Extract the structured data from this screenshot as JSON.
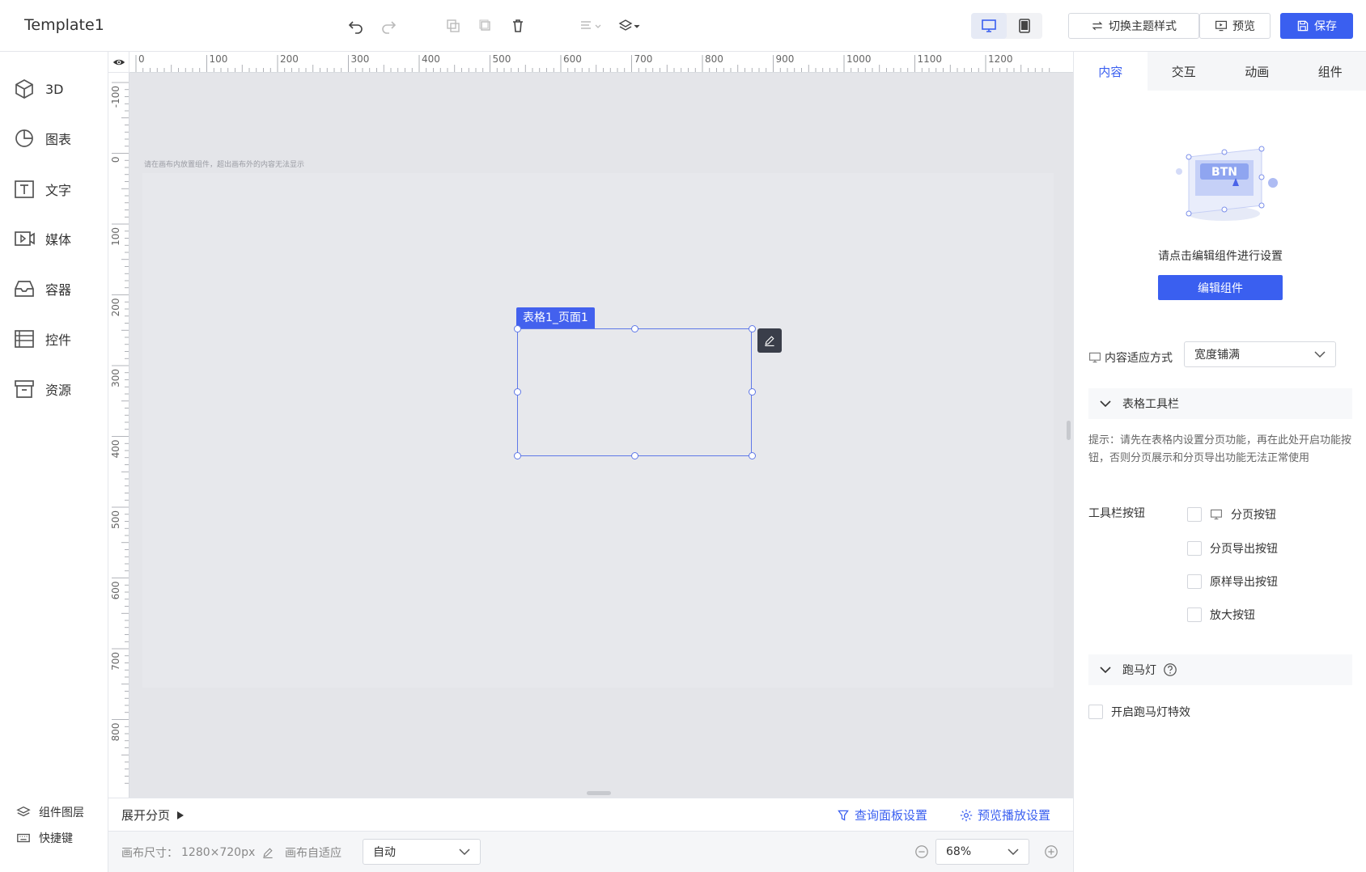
{
  "app": {
    "title": "Template1"
  },
  "toolbar": {
    "switch_theme_label": "切换主题样式",
    "preview_label": "预览",
    "save_label": "保存"
  },
  "sidebar": {
    "items": [
      {
        "label": "3D",
        "icon": "cube-icon"
      },
      {
        "label": "图表",
        "icon": "pie-chart-icon"
      },
      {
        "label": "文字",
        "icon": "text-icon"
      },
      {
        "label": "媒体",
        "icon": "media-icon"
      },
      {
        "label": "容器",
        "icon": "container-icon"
      },
      {
        "label": "控件",
        "icon": "control-icon"
      },
      {
        "label": "资源",
        "icon": "resource-icon"
      }
    ],
    "bottom": [
      {
        "label": "组件图层",
        "icon": "layers-icon"
      },
      {
        "label": "快捷键",
        "icon": "keyboard-icon"
      }
    ]
  },
  "ruler": {
    "top_labels": [
      "0",
      "100",
      "200",
      "300",
      "400",
      "500",
      "600",
      "700",
      "800",
      "900",
      "1000",
      "1100",
      "1200"
    ],
    "left_labels": [
      "-100",
      "0",
      "100",
      "200",
      "300",
      "400",
      "500",
      "600",
      "700",
      "800"
    ]
  },
  "canvas": {
    "hint": "请在画布内放置组件，超出画布外的内容无法显示",
    "selected_component_label": "表格1_页面1"
  },
  "pager": {
    "expand_label": "展开分页",
    "query_panel_label": "查询面板设置",
    "preview_play_label": "预览播放设置"
  },
  "status": {
    "canvas_size_label": "画布尺寸：",
    "canvas_size_value": "1280×720px",
    "auto_fit_label": "画布自适应",
    "auto_fit_value": "自动",
    "zoom_value": "68%"
  },
  "panel": {
    "tabs": [
      {
        "label": "内容",
        "active": true
      },
      {
        "label": "交互",
        "active": false
      },
      {
        "label": "动画",
        "active": false
      },
      {
        "label": "组件",
        "active": false
      }
    ],
    "illustration_text": "BTN",
    "hint": "请点击编辑组件进行设置",
    "edit_button_label": "编辑组件",
    "fit_mode_label": "内容适应方式",
    "fit_mode_value": "宽度铺满",
    "table_toolbar_section": "表格工具栏",
    "tip": "提示：请先在表格内设置分页功能，再在此处开启功能按钮，否则分页展示和分页导出功能无法正常使用",
    "toolbar_buttons_label": "工具栏按钮",
    "toolbar_options": [
      {
        "label": "分页按钮",
        "checked": false
      },
      {
        "label": "分页导出按钮",
        "checked": false
      },
      {
        "label": "原样导出按钮",
        "checked": false
      },
      {
        "label": "放大按钮",
        "checked": false
      }
    ],
    "marquee_section": "跑马灯",
    "marquee_option": "开启跑马灯特效"
  },
  "colors": {
    "accent": "#3a5ff0",
    "selection": "#4361ee",
    "canvas_bg": "#e4e5e9"
  }
}
